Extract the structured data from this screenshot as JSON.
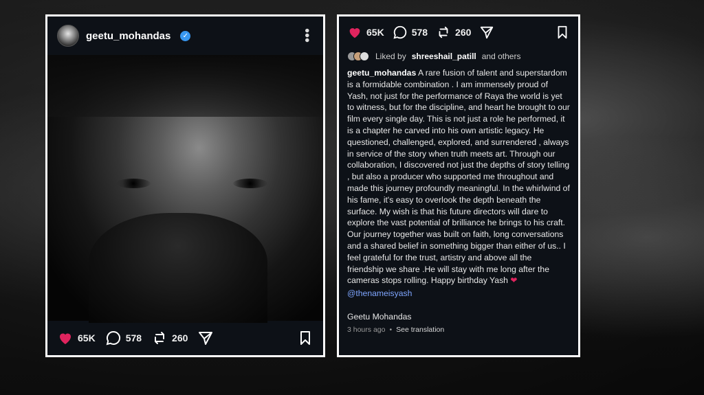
{
  "post": {
    "username": "geetu_mohandas",
    "verified_icon": "verified-badge-icon",
    "menu_icon": "more-options-icon"
  },
  "actions": {
    "likes": "65K",
    "comments": "578",
    "reposts": "260",
    "like_icon": "heart-icon",
    "comment_icon": "comment-icon",
    "repost_icon": "repost-icon",
    "share_icon": "send-icon",
    "save_icon": "bookmark-icon",
    "like_color": "#e0245e"
  },
  "liked_by": {
    "prefix": "Liked by",
    "user": "shreeshail_patill",
    "suffix": "and others"
  },
  "caption": {
    "username": "geetu_mohandas",
    "text": "A rare fusion of talent and superstardom is a formidable combination . I am immensely proud of Yash,  not just for the performance of Raya the world is yet to witness, but for the discipline, and heart he brought to our film every single day. This is not just a role he performed, it is a chapter he carved into his own artistic legacy. He questioned, challenged, explored, and surrendered , always in service of the story when truth meets art. Through our collaboration, I discovered not just the depths of story telling , but also a producer who supported me throughout and made this journey profoundly meaningful. In the whirlwind of his fame, it's easy to overlook the depth beneath the surface. My wish is that his future directors will dare to explore the vast potential of brilliance he brings to his craft. Our journey together was built on faith, long conversations and a shared belief in something bigger than either of us.. I feel grateful for the trust, artistry and above all the friendship we share .He will stay with me long after the cameras stops rolling. Happy birthday Yash",
    "heart": "❤",
    "mention": "@thenameisyash",
    "signature": "Geetu Mohandas"
  },
  "meta": {
    "time": "3 hours ago",
    "separator": "•",
    "translate": "See translation"
  }
}
